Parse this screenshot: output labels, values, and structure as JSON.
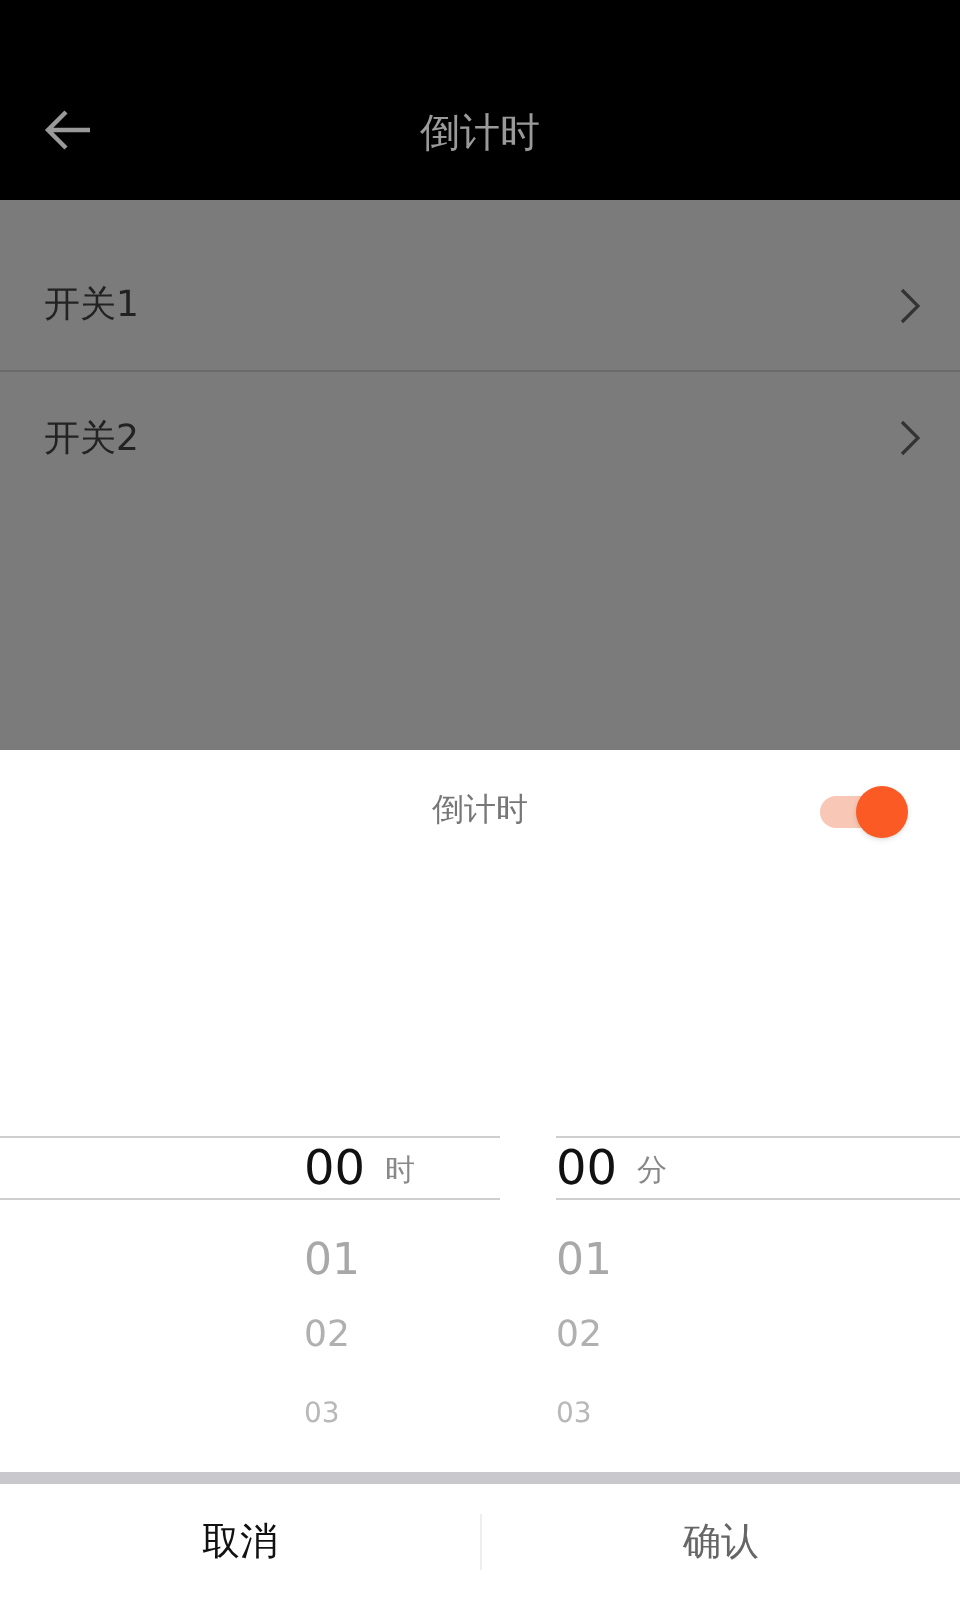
{
  "header": {
    "title": "倒计时"
  },
  "list": [
    {
      "label": "开关1"
    },
    {
      "label": "开关2"
    }
  ],
  "sheet": {
    "title": "倒计时",
    "toggle": {
      "on": true
    },
    "pickers": [
      {
        "unit": "时",
        "items": [
          {
            "label": "00",
            "selected": true
          },
          {
            "label": "01",
            "selected": false
          },
          {
            "label": "02",
            "selected": false
          },
          {
            "label": "03",
            "selected": false
          }
        ]
      },
      {
        "unit": "分",
        "items": [
          {
            "label": "00",
            "selected": true
          },
          {
            "label": "01",
            "selected": false
          },
          {
            "label": "02",
            "selected": false
          },
          {
            "label": "03",
            "selected": false
          }
        ]
      }
    ],
    "buttons": [
      {
        "label": "取消"
      },
      {
        "label": "确认"
      }
    ]
  }
}
